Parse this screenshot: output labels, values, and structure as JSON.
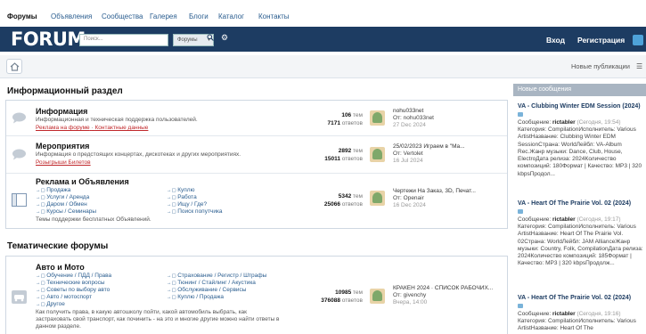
{
  "sitenav": [
    "Форумы",
    "Объявления",
    "Сообщества",
    "Галерея",
    "Блоги",
    "Каталог",
    "Контакты"
  ],
  "header": {
    "logo": "FORUM",
    "search_placeholder": "Поиск...",
    "scope": "Форумы",
    "login": "Вход",
    "register": "Регистрация"
  },
  "breadcrumb": {
    "new_pubs": "Новые публикации"
  },
  "sections": {
    "info_title": "Информационный раздел",
    "thematic_title": "Тематические форумы"
  },
  "forums": [
    {
      "name": "Информация",
      "desc": "Информационная и техническая поддержка пользователей.",
      "links": [
        "Реклама на форуме",
        "Контактные данные"
      ],
      "topics": "106",
      "topics_label": "тем",
      "replies": "7171",
      "replies_label": "ответов",
      "last_title": "nohu033net",
      "last_from": "От: nohu033net",
      "last_date": "27 Dec 2024"
    },
    {
      "name": "Мероприятия",
      "desc": "Информация о предстоящих концертах, дискотеках и других мероприятиях.",
      "links": [
        "Розыгрыши Билетов"
      ],
      "topics": "2892",
      "topics_label": "тем",
      "replies": "15011",
      "replies_label": "ответов",
      "last_title": "25/02/2023 Играем в \"Ма...",
      "last_from": "От: Vertolet",
      "last_date": "16 Jul 2024"
    },
    {
      "name": "Реклама и Объявления",
      "subs_left": [
        "Продажа",
        "Услуги / Аренда",
        "Даром / Обмен",
        "Курсы / Семинары"
      ],
      "subs_right": [
        "Куплю",
        "Работа",
        "Ищу / Где?",
        "Поиск попутчика"
      ],
      "desc": "Темы поддержки бесплатных Объявлений.",
      "topics": "5342",
      "topics_label": "тем",
      "replies": "25066",
      "replies_label": "ответов",
      "last_title": "Чертежи На Заказ, 3D, Печат...",
      "last_from": "От: Openair",
      "last_date": "16 Dec 2024"
    },
    {
      "name": "Авто и Мото",
      "subs_left": [
        "Обучение / ПДД / Права",
        "Технические вопросы",
        "Советы по выбору авто",
        "Авто / мотоспорт",
        "Другое"
      ],
      "subs_right": [
        "Страхование / Регистр / Штрафы",
        "Тюнинг / Стайлинг / Акустика",
        "Обслуживание / Сервисы",
        "Куплю / Продажа"
      ],
      "desc_lines": [
        "Как получить права, в какую автошколу пойти, какой автомобиль выбрать, как",
        "застраховать свой транспорт, как починить - на это и многие другие можно найти ответы в",
        "данном разделе."
      ],
      "topics": "10985",
      "topics_label": "тем",
      "replies": "376088",
      "replies_label": "ответов",
      "last_title": "КРАКЕН 2024 · СПИСОК РАБОЧИХ...",
      "last_from": "От: givenchy",
      "last_date": "Вчера, 14:00"
    }
  ],
  "right": {
    "heading": "Новые сообщения",
    "posts": [
      {
        "title": "VA - Clubbing Winter EDM Session (2024)",
        "author_prefix": "Сообщение: ",
        "author": "rictabler",
        "date": "(Сегодня, 19:54)",
        "text": "Категория: CompilationИсполнитель: Various ArtistНазвание: Clubbing Winter EDM SessionСтрана: WorldЛейбл: VA-Album Rec.Жанр музыки: Dance, Club, House, ElectroДата релиза: 2024Количество композиций: 180Формат | Качество: MP3 | 320 kbpsПродол..."
      },
      {
        "title": "VA - Heart Of The Prairie Vol. 02 (2024)",
        "author_prefix": "Сообщение: ",
        "author": "rictabler",
        "date": "(Сегодня, 19:17)",
        "text": "Категория: CompilationИсполнитель: Various ArtistНазвание: Heart Of The Prairie Vol. 02Страна: WorldЛейбл: JAM AllianceЖанр музыки: Country, Folk, CompilationДата релиза: 2024Количество композиций: 185Формат | Качество: MP3 | 320 kbpsПродолж..."
      },
      {
        "title": "VA - Heart Of The Prairie Vol. 02 (2024)",
        "author_prefix": "Сообщение: ",
        "author": "rictabler",
        "date": "(Сегодня, 19:16)",
        "text": "Категория: CompilationИсполнитель: Various ArtistНазвание: Heart Of The"
      }
    ]
  },
  "colors": {
    "header_bg": "#1d3c62",
    "link": "#2a5d8f",
    "accent_red": "#c0282b",
    "right_head": "#a9b5c2"
  }
}
